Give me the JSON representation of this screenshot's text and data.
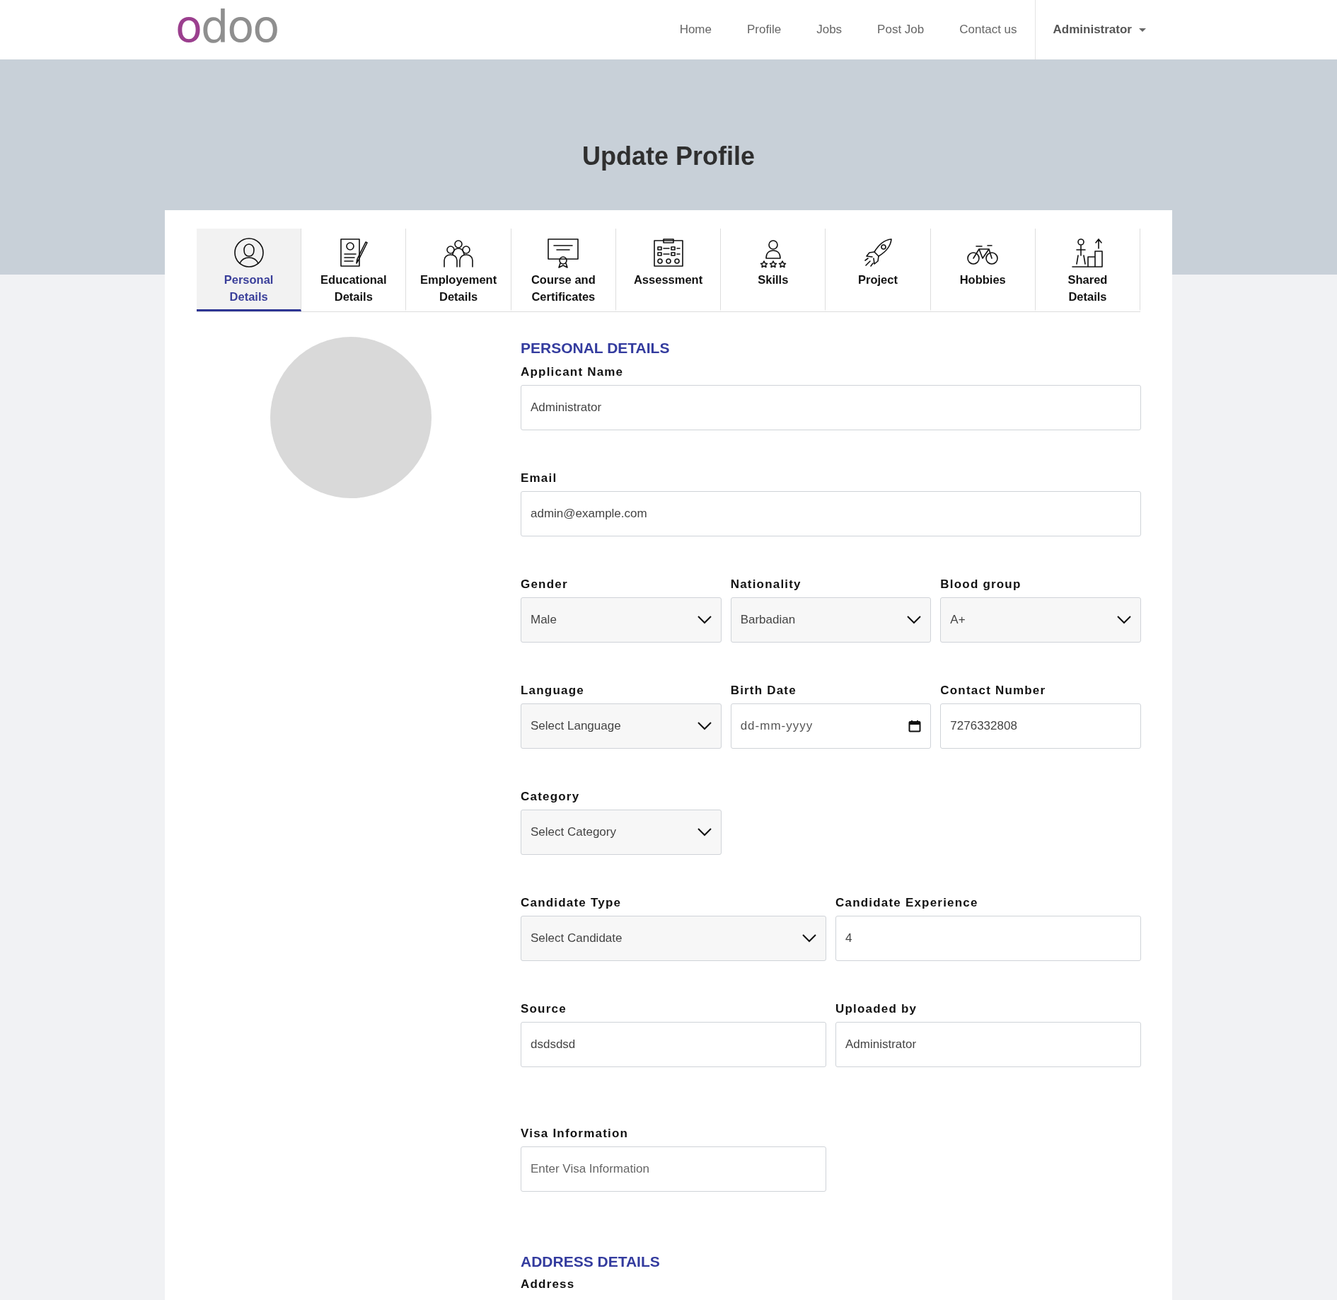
{
  "navbar": {
    "logo": "odoo",
    "links": [
      {
        "label": "Home"
      },
      {
        "label": "Profile"
      },
      {
        "label": "Jobs"
      },
      {
        "label": "Post Job"
      },
      {
        "label": "Contact us"
      }
    ],
    "user_menu": "Administrator"
  },
  "banner": {
    "title": "Update Profile"
  },
  "tabs": [
    {
      "label": "Personal Details",
      "kind": "person",
      "selected": true
    },
    {
      "label": "Educational Details",
      "kind": "document",
      "selected": false
    },
    {
      "label": "Employement Details",
      "kind": "group",
      "selected": false
    },
    {
      "label": "Course and Certificates",
      "kind": "certificate",
      "selected": false
    },
    {
      "label": "Assessment",
      "kind": "checklist",
      "selected": false
    },
    {
      "label": "Skills",
      "kind": "stars",
      "selected": false
    },
    {
      "label": "Project",
      "kind": "rocket",
      "selected": false
    },
    {
      "label": "Hobbies",
      "kind": "bicycle",
      "selected": false
    },
    {
      "label": "Shared Details",
      "kind": "podium",
      "selected": false
    }
  ],
  "personal_details": {
    "title": "PERSONAL DETAILS",
    "rows": [
      {
        "fields": [
          {
            "label": "Applicant Name",
            "kind": "text",
            "value": "Administrator"
          }
        ]
      },
      {
        "fields": [
          {
            "label": "Email",
            "kind": "text",
            "value": "admin@example.com"
          }
        ]
      },
      {
        "fields": [
          {
            "label": "Gender",
            "kind": "select",
            "value": "Male"
          },
          {
            "label": "Nationality",
            "kind": "select",
            "value": "Barbadian"
          },
          {
            "label": "Blood group",
            "kind": "select",
            "value": "A+"
          }
        ]
      },
      {
        "fields": [
          {
            "label": "Language",
            "kind": "select",
            "value": "Select Language"
          },
          {
            "label": "Birth Date",
            "kind": "date",
            "placeholder": "dd-mm-yyyy"
          },
          {
            "label": "Contact Number",
            "kind": "text",
            "value": "7276332808"
          }
        ]
      },
      {
        "fields": [
          {
            "label": "Category",
            "kind": "select",
            "value": "Select Category"
          }
        ]
      },
      {
        "fields": [
          {
            "label": "Candidate Type",
            "kind": "select",
            "value": "Select Candidate"
          },
          {
            "label": "Candidate Experience",
            "kind": "text",
            "value": "4"
          }
        ]
      },
      {
        "fields": [
          {
            "label": "Source",
            "kind": "text",
            "value": "dsdsdsd"
          },
          {
            "label": "Uploaded by",
            "kind": "text",
            "value": "Administrator"
          }
        ]
      },
      {
        "fields": [
          {
            "label": "Visa Information",
            "kind": "text",
            "placeholder": "Enter Visa Information"
          }
        ]
      }
    ]
  },
  "address_details": {
    "title": "ADDRESS DETAILS",
    "first_label": "Address"
  }
}
